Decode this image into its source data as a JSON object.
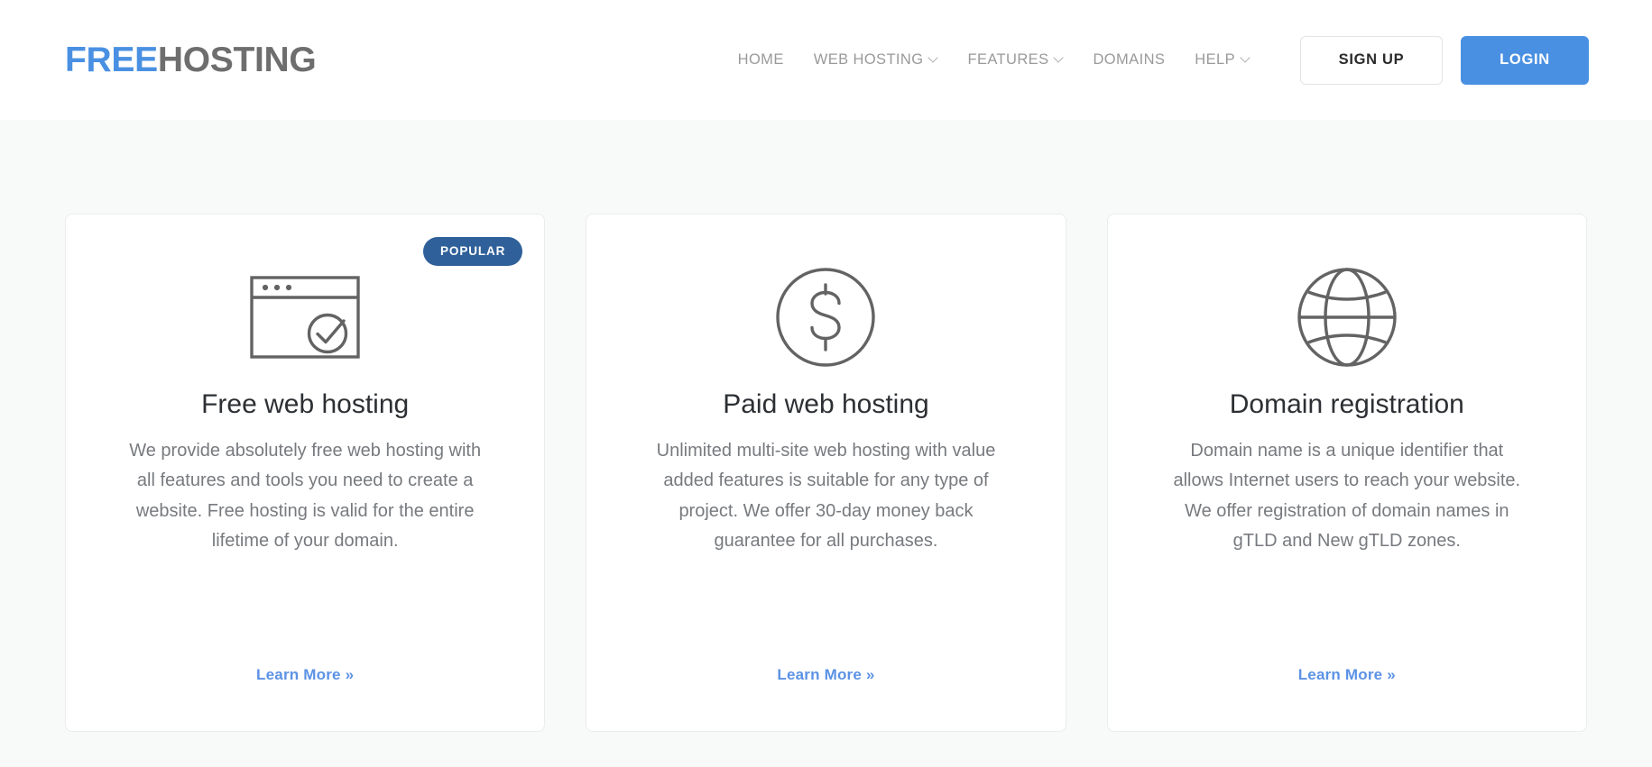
{
  "header": {
    "logo": {
      "primary": "FREE",
      "secondary": "HOSTING"
    },
    "nav": [
      {
        "label": "HOME",
        "has_dropdown": false
      },
      {
        "label": "WEB HOSTING",
        "has_dropdown": true
      },
      {
        "label": "FEATURES",
        "has_dropdown": true
      },
      {
        "label": "DOMAINS",
        "has_dropdown": false
      },
      {
        "label": "HELP",
        "has_dropdown": true
      }
    ],
    "signup_label": "SIGN UP",
    "login_label": "LOGIN"
  },
  "cards": [
    {
      "badge": "POPULAR",
      "icon": "browser-window-check-icon",
      "title": "Free web hosting",
      "text": "We provide absolutely free web hosting with all features and tools you need to create a website. Free hosting is valid for the entire lifetime of your domain.",
      "link": "Learn More »"
    },
    {
      "badge": "",
      "icon": "dollar-circle-icon",
      "title": "Paid web hosting",
      "text": "Unlimited multi-site web hosting with value added features is suitable for any type of project. We offer 30-day money back guarantee for all purchases.",
      "link": "Learn More »"
    },
    {
      "badge": "",
      "icon": "globe-icon",
      "title": "Domain registration",
      "text": "Domain name is a unique identifier that allows Internet users to reach your website. We offer registration of domain names in gTLD and New gTLD zones.",
      "link": "Learn More »"
    }
  ],
  "colors": {
    "brand_blue": "#4a90e2",
    "badge_blue": "#2f6099",
    "link_blue": "#5b92e5",
    "logo_gray": "#6e6e6e",
    "page_bg": "#f8f9f9",
    "icon_stroke": "#636363"
  }
}
